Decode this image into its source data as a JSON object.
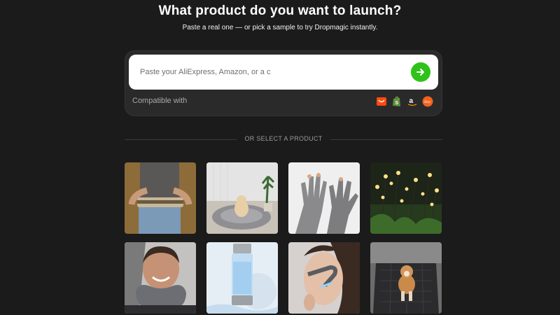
{
  "header": {
    "title": "What product do you want to launch?",
    "subtitle": "Paste a real one — or pick a sample to try Dropmagic instantly."
  },
  "search": {
    "placeholder": "Paste your AliExpress, Amazon, or a c",
    "submit_icon": "arrow-right-icon",
    "accent_color": "#2fc21a"
  },
  "compatibility": {
    "label": "Compatible with",
    "stores": [
      {
        "name": "aliexpress-icon",
        "color": "#ff4a0f"
      },
      {
        "name": "shopify-icon",
        "color": "#5e8e3e"
      },
      {
        "name": "amazon-icon",
        "color": "#ffffff"
      },
      {
        "name": "etsy-icon",
        "color": "#f1641e",
        "text": "Etsy"
      }
    ]
  },
  "divider": {
    "text": "OR SELECT A PRODUCT"
  },
  "products": [
    {
      "name": "posture-belt",
      "bg": "#8a6a3c"
    },
    {
      "name": "dog-bed",
      "bg": "#ececec"
    },
    {
      "name": "compression-gloves",
      "bg": "#e8e8e8"
    },
    {
      "name": "firefly-lights",
      "bg": "#1e2a1a"
    },
    {
      "name": "travel-pillow",
      "bg": "#8a8a8a"
    },
    {
      "name": "hydrogen-water-bottle",
      "bg": "#dfe8f0"
    },
    {
      "name": "face-massager",
      "bg": "#d8d4d2"
    },
    {
      "name": "car-seat-cover",
      "bg": "#5a5a5a"
    }
  ]
}
